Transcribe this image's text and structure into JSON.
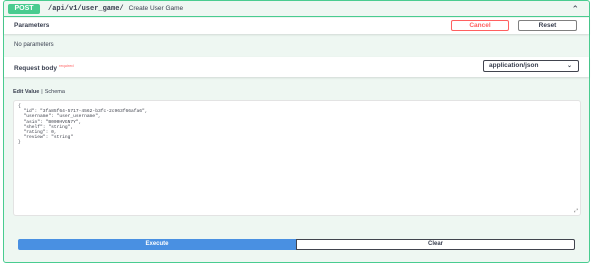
{
  "operation": {
    "method": "POST",
    "path": "/api/v1/user_game/",
    "summary": "Create User Game",
    "colors": {
      "method": "#49cc90",
      "background": "#eef7f2"
    }
  },
  "parameters": {
    "title": "Parameters",
    "cancel_label": "Cancel",
    "reset_label": "Reset",
    "empty_text": "No parameters"
  },
  "request_body": {
    "title": "Request body",
    "required_label": "required",
    "content_type": "application/json"
  },
  "editor": {
    "tab_example": "Edit Value",
    "tab_separator": "|",
    "tab_schema": "Schema",
    "value": "{\n  \"id\": \"3fa85f64-5717-4562-b3fc-2c963f66afa6\",\n  \"username\": \"user_username\",\n  \"asin\": \"B000HVGN7Y\",\n  \"shelf\": \"string\",\n  \"rating\": 0,\n  \"review\": \"string\"\n}"
  },
  "actions": {
    "execute_label": "Execute",
    "clear_label": "Clear",
    "execute_color": "#4990e2"
  }
}
